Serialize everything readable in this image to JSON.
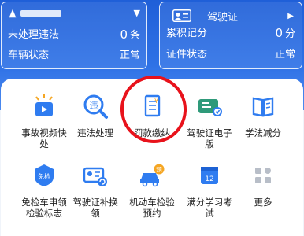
{
  "vehicle_card": {
    "chevron": "▼",
    "rows": [
      {
        "label": "未处理违法",
        "value": "0",
        "unit": "条"
      },
      {
        "label": "车辆状态",
        "value": "正常"
      }
    ]
  },
  "license_card": {
    "title": "驾驶证",
    "arrow": "▶",
    "rows": [
      {
        "label": "累积记分",
        "value": "0",
        "unit": "分"
      },
      {
        "label": "证件状态",
        "value": "正常"
      }
    ]
  },
  "services": [
    {
      "label": "事故视频快处",
      "icon": "camera-alarm-icon"
    },
    {
      "label": "违法处理",
      "icon": "violation-search-icon"
    },
    {
      "label": "罚款缴纳",
      "icon": "fine-payment-icon"
    },
    {
      "label": "驾驶证电子版",
      "icon": "e-license-icon"
    },
    {
      "label": "学法减分",
      "icon": "book-icon"
    },
    {
      "label": "免检车申领检验标志",
      "icon": "exempt-badge-icon"
    },
    {
      "label": "驾驶证补换领",
      "icon": "license-renew-icon"
    },
    {
      "label": "机动车检验预约",
      "icon": "vehicle-inspection-icon"
    },
    {
      "label": "满分学习考试",
      "icon": "calendar-12-icon"
    },
    {
      "label": "更多",
      "icon": "more-grid-icon"
    }
  ],
  "calendar_day": "12",
  "badges": {
    "violation": "违",
    "fine": "¥",
    "exempt": "免检",
    "booking": "预"
  },
  "colors": {
    "header_blue": "#2a6be2",
    "icon_blue": "#2f7cf0",
    "icon_orange": "#f5a623",
    "highlight_red": "#e8121b"
  }
}
